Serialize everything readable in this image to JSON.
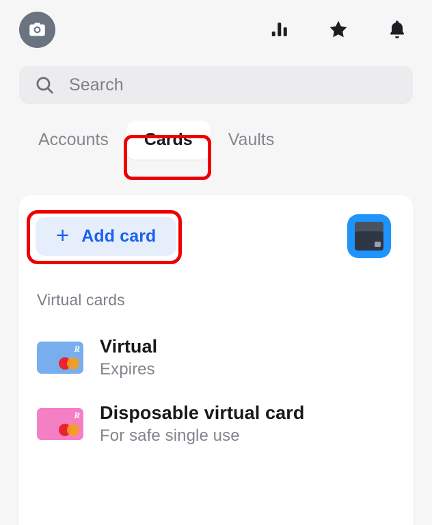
{
  "header": {
    "avatar_icon": "camera-icon",
    "actions": [
      {
        "name": "analytics-icon",
        "label": "Analytics"
      },
      {
        "name": "star-icon",
        "label": "Favourites"
      },
      {
        "name": "bell-icon",
        "label": "Notifications"
      }
    ]
  },
  "search": {
    "icon": "search-icon",
    "placeholder": "Search",
    "value": ""
  },
  "tabs": [
    {
      "label": "Accounts",
      "active": false
    },
    {
      "label": "Cards",
      "active": true
    },
    {
      "label": "Vaults",
      "active": false
    }
  ],
  "panel": {
    "add_card": {
      "icon": "plus-icon",
      "label": "Add card"
    },
    "card_stack_thumb": "card-stack-icon",
    "section_title": "Virtual cards",
    "items": [
      {
        "title": "Virtual",
        "subtitle": "Expires",
        "card_color": "#78aeee",
        "brand_mark": "R",
        "network_icon": "mastercard-icon"
      },
      {
        "title": "Disposable virtual card",
        "subtitle": "For safe single use",
        "card_color": "#f57fc4",
        "brand_mark": "R",
        "network_icon": "mastercard-icon"
      }
    ]
  },
  "annotations": {
    "color": "#ee0000",
    "targets": [
      "Cards",
      "Add card"
    ]
  },
  "colors": {
    "accent_blue": "#1a62ef",
    "page_bg": "#f6f6f7",
    "panel_bg": "#ffffff",
    "annotation_red": "#ee0000"
  }
}
